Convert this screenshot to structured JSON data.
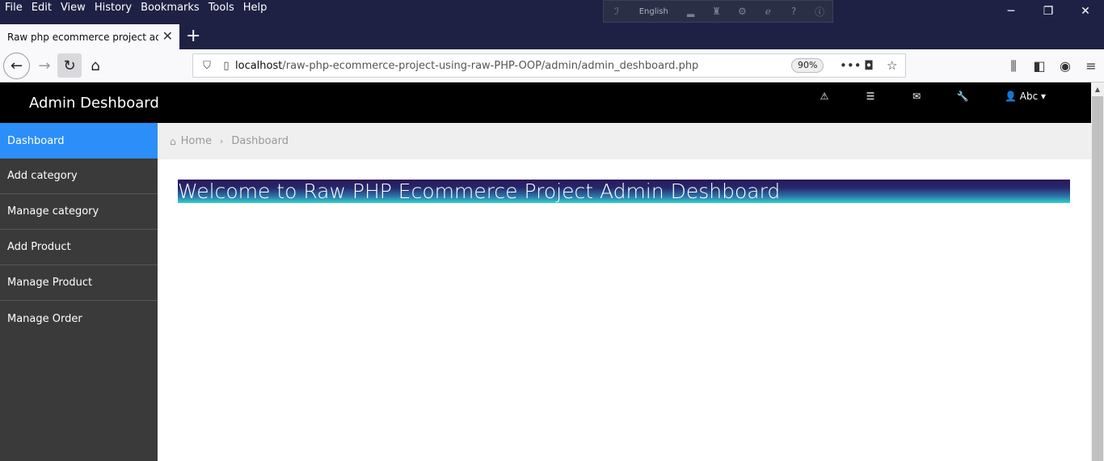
{
  "browser": {
    "menu": [
      "File",
      "Edit",
      "View",
      "History",
      "Bookmarks",
      "Tools",
      "Help"
    ],
    "extension_language": "English",
    "tab_title": "Raw php ecommerce project admin",
    "url_host": "localhost",
    "url_path": "/raw-php-ecommerce-project-using-raw-PHP-OOP/admin/admin_deshboard.php",
    "zoom": "90%"
  },
  "admin": {
    "brand": "Admin Deshboard",
    "user_label": "Abc"
  },
  "sidebar": {
    "items": [
      {
        "label": "Dashboard",
        "active": true
      },
      {
        "label": "Add category"
      },
      {
        "label": "Manage category"
      },
      {
        "label": "Add Product"
      },
      {
        "label": "Manage Product"
      },
      {
        "label": "Manage Order"
      }
    ]
  },
  "breadcrumb": {
    "home": "Home",
    "current": "Dashboard"
  },
  "main": {
    "welcome": "Welcome to Raw PHP Ecommerce Project Admin Deshboard"
  },
  "colors": {
    "sidebar_active": "#2c8ef8",
    "sidebar_bg": "#3a3a3a",
    "topbar_bg": "#000000",
    "browser_chrome": "#1f2144"
  }
}
